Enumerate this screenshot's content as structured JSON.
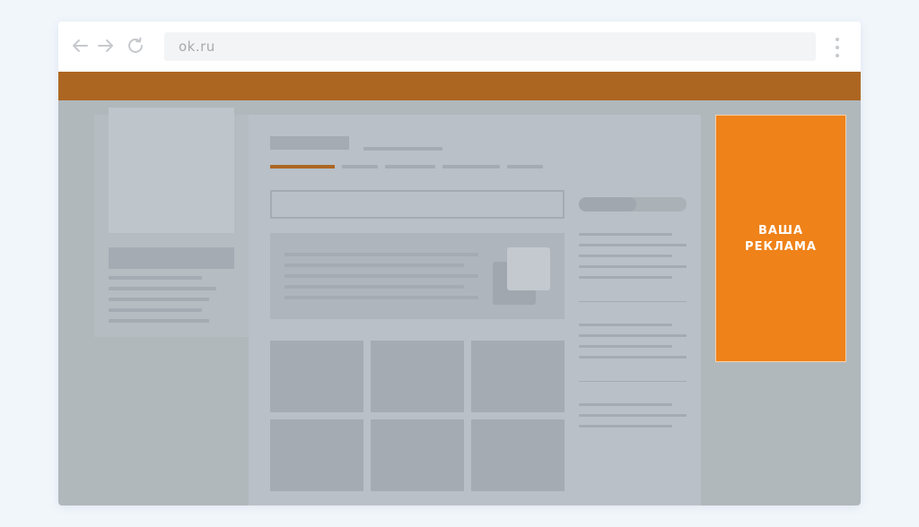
{
  "browser": {
    "url": "ok.ru",
    "icons": [
      "back-arrow-icon",
      "forward-arrow-icon",
      "reload-icon",
      "more-vert-icon"
    ]
  },
  "colors": {
    "brand_bar": "#ad6622",
    "ad_background": "#ef8219",
    "page_overlay": "#b0b8bc"
  },
  "ad": {
    "text": "ВАША\nРЕКЛАМА"
  }
}
